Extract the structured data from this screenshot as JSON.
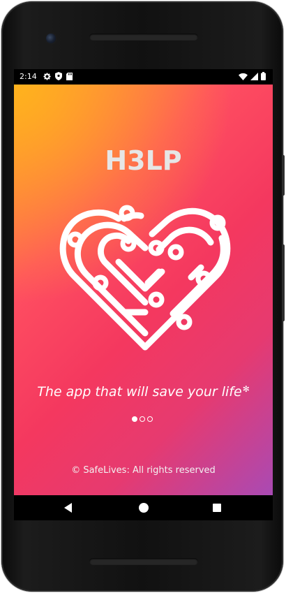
{
  "status_bar": {
    "time": "2:14",
    "icons_left": [
      "gear-icon",
      "shield-icon",
      "sd-card-icon"
    ],
    "icons_right": [
      "wifi-icon",
      "cell-signal-icon",
      "battery-icon"
    ]
  },
  "app": {
    "title": "H3LP",
    "logo": "heart-circuit-logo",
    "tagline": "The app that will save your life",
    "tagline_decoration": "sparkle-icon",
    "pager": {
      "count": 3,
      "active_index": 0
    },
    "copyright": "© SafeLives: All rights reserved"
  },
  "colors": {
    "gradient_start": "#ffb21d",
    "gradient_mid": "#f4385f",
    "gradient_end": "#a94ab4",
    "title_color": "#e6e6e6",
    "text_color": "#ffffff"
  },
  "nav_bar": {
    "buttons": [
      "back-icon",
      "home-icon",
      "recents-icon"
    ]
  }
}
